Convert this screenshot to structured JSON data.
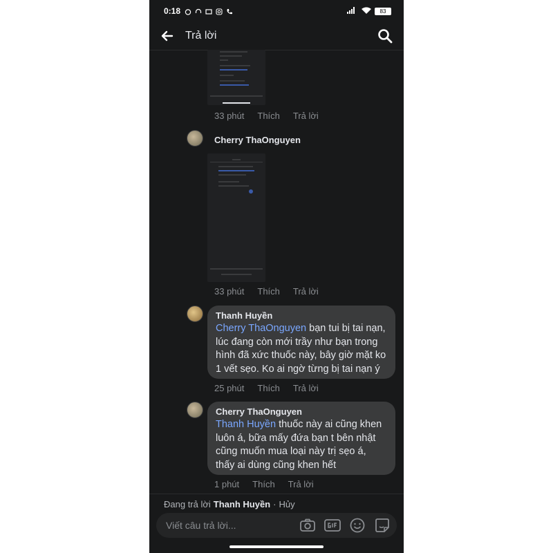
{
  "status_bar": {
    "time": "0:18",
    "battery": "83"
  },
  "header": {
    "title": "Trả lời"
  },
  "comments": [
    {
      "time": "33 phút",
      "like": "Thích",
      "reply": "Trả lời"
    },
    {
      "author": "Cherry ThaOnguyen",
      "time": "33 phút",
      "like": "Thích",
      "reply": "Trả lời"
    },
    {
      "author": "Thanh Huyền",
      "mention": "Cherry ThaOnguyen",
      "text": " bạn tui bị tai nạn, lúc đang còn mới trầy như bạn trong hình đã xức thuốc này, bây giờ mặt ko 1 vết sẹo. Ko ai ngờ  từng bị tai nạn ý",
      "time": "25 phút",
      "like": "Thích",
      "reply": "Trả lời"
    },
    {
      "author": "Cherry ThaOnguyen",
      "mention": "Thanh Huyền",
      "text": " thuốc này ai cũng khen luôn á, bữa  mấy đứa bạn t bên nhật cũng muốn mua loại này trị sẹo á, thấy ai dùng cũng khen hết",
      "time": "1 phút",
      "like": "Thích",
      "reply": "Trả lời"
    }
  ],
  "reply_bar": {
    "prefix": "Đang trả lời",
    "name": "Thanh Huyền",
    "separator": "·",
    "cancel": "Hủy"
  },
  "composer": {
    "placeholder": "Viết câu trả lời..."
  },
  "icons": {
    "back": "arrow-left-icon",
    "search": "search-icon",
    "camera": "camera-icon",
    "gif": "gif-icon",
    "emoji": "smiley-icon",
    "sticker": "sticker-icon"
  }
}
